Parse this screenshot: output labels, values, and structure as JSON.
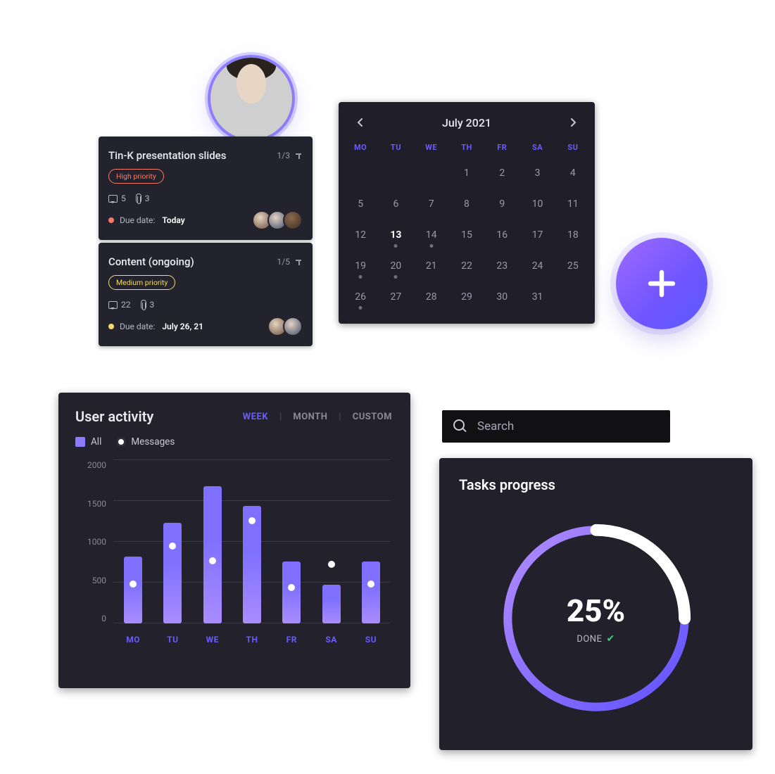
{
  "tasks": [
    {
      "title": "Tin-K presentation slides",
      "subtask": "1/3",
      "priority": {
        "label": "High priority",
        "level": "high"
      },
      "comments": 5,
      "attachments": 3,
      "due": {
        "label": "Due date:",
        "value": "Today",
        "color": "red"
      },
      "assignees": 3
    },
    {
      "title": "Content (ongoing)",
      "subtask": "1/5",
      "priority": {
        "label": "Medium priority",
        "level": "medium"
      },
      "comments": 22,
      "attachments": 3,
      "due": {
        "label": "Due date:",
        "value": "July 26, 21",
        "color": "yellow"
      },
      "assignees": 2
    }
  ],
  "calendar": {
    "title": "July 2021",
    "dow": [
      "MO",
      "TU",
      "WE",
      "TH",
      "FR",
      "SA",
      "SU"
    ],
    "leading_blanks": 3,
    "last_day": 31,
    "selected": 13,
    "event_days": [
      13,
      14,
      19,
      20,
      26
    ]
  },
  "search": {
    "placeholder": "Search"
  },
  "activity": {
    "title": "User activity",
    "tabs": {
      "week": "WEEK",
      "month": "MONTH",
      "custom": "CUSTOM",
      "active": "week"
    },
    "legend": {
      "all": "All",
      "messages": "Messages"
    }
  },
  "chart_data": {
    "type": "bar",
    "title": "User activity",
    "xlabel": "",
    "ylabel": "",
    "ylim": [
      0,
      2000
    ],
    "y_ticks": [
      0,
      500,
      1000,
      1500,
      2000
    ],
    "categories": [
      "MO",
      "TU",
      "WE",
      "TH",
      "FR",
      "SA",
      "SU"
    ],
    "series": [
      {
        "name": "All",
        "values": [
          820,
          1230,
          1680,
          1440,
          760,
          470,
          760
        ]
      },
      {
        "name": "Messages",
        "values": [
          480,
          950,
          770,
          1260,
          440,
          720,
          480
        ]
      }
    ]
  },
  "progress": {
    "title": "Tasks progress",
    "percent": 25,
    "percent_label": "25%",
    "done_label": "DONE"
  },
  "colors": {
    "accent": "#6a5cff",
    "card_bg": "#22212c",
    "text_muted": "#8a8999"
  }
}
